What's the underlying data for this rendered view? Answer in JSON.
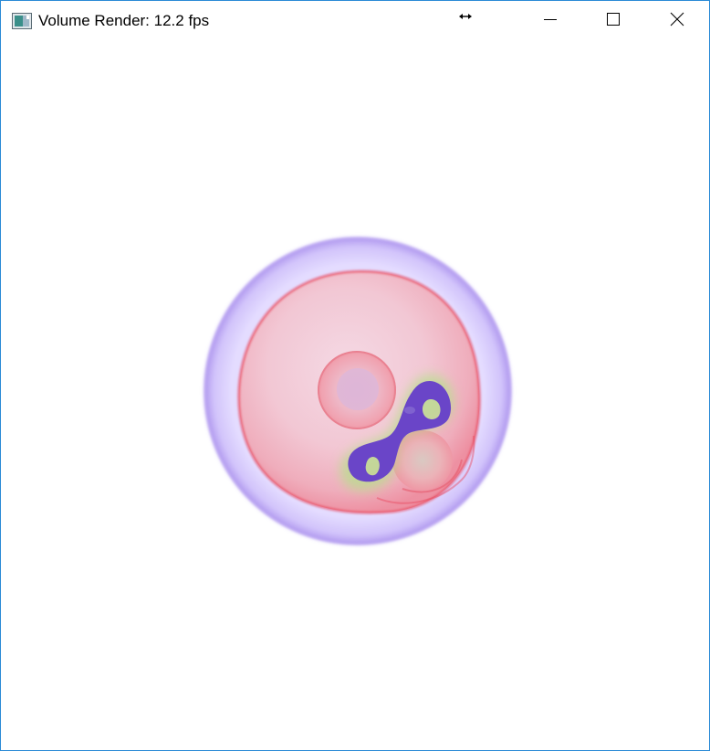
{
  "window": {
    "title": "Volume Render: 12.2 fps"
  },
  "titlebar": {
    "app_icon": "app-window-icon",
    "resize_icon": "horizontal-resize-icon",
    "buttons": {
      "minimize_icon": "minimize-icon",
      "maximize_icon": "maximize-icon",
      "close_icon": "close-icon"
    }
  },
  "colors": {
    "window_border": "#2b8ad6",
    "outer_shell": "#b9a4f2",
    "inner_membrane": "#f0a0ae",
    "membrane_edge": "#e8485e",
    "blob": "#6a45c8",
    "glow": "#b6e08a"
  }
}
